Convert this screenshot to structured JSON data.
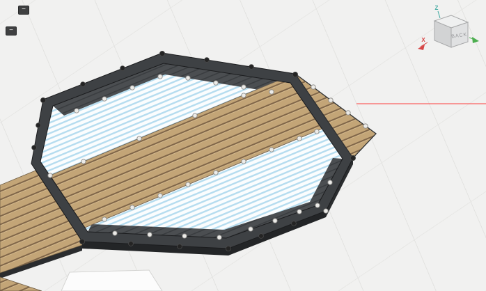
{
  "app": {
    "name": "3d-cad-viewport"
  },
  "toolbar": {
    "collapse_top_glyph": "−",
    "collapse_side_glyph": "−"
  },
  "view_cube": {
    "face_label": "BACK",
    "x_label": "X",
    "z_label": "Z",
    "colors": {
      "x_axis": "#d64545",
      "y_axis": "#4cae4f",
      "z_axis": "#3aa79e",
      "face_top": "#eff0f0",
      "face_front": "#e0e1e2",
      "face_left": "#d2d3d4",
      "edge": "#a8a9aa",
      "label_text": "#96979a"
    }
  },
  "scene": {
    "background": "#f1f1f0",
    "grid_line_color": "#e3e3e1",
    "x_axis_line_color": "#fb5252"
  },
  "model": {
    "name": "octagonal-deck-frame",
    "frame_color": "#3e4144",
    "frame_outline_color": "#1b1c1e",
    "wood_color": "#c3a577",
    "wood_gap_color": "#806649",
    "panel_color": "#fbfdfe",
    "panel_stripe_color": "#b5dcef",
    "edging_color": "#4b4e51",
    "vertex_dark_color": "#242424",
    "vertex_light_color": "#ecebe8",
    "sketch_plane_fill": "#fcfcfc",
    "sketch_plane_edge": "#d5d5d3"
  }
}
